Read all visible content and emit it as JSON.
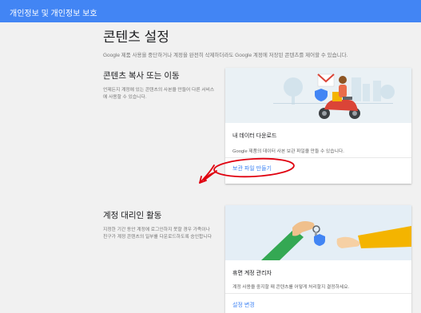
{
  "header": {
    "title": "개인정보 및 개인정보 보호"
  },
  "page": {
    "title": "콘텐츠 설정",
    "description": "Google 제품 사용을 중단하거나 계정을 완전히 삭제하더라도 Google 계정에 저장된 콘텐츠를 제어할 수 있습니다."
  },
  "sections": [
    {
      "title": "콘텐츠 복사 또는 이동",
      "description": "언제든지 계정에 있는 콘텐츠의 사본을 만들어 다른 서비스에 사용할 수 있습니다.",
      "card": {
        "title": "내 데이터 다운로드",
        "description": "Google 제품의 데이터 사본 보관 파일을 만들 수 있습니다.",
        "link": "보관 파일 만들기",
        "hero_color": "#eaf1f5"
      }
    },
    {
      "title": "계정 대리인 활동",
      "description": "지정한 기간 동안 계정에 로그인하지 못할 경우 가족이나 친구가 계정 콘텐츠의 일부를 다운로드하도록 승인합니다",
      "card": {
        "title": "휴면 계정 관리자",
        "description": "계정 사용을 중지할 때 콘텐츠를 어떻게 처리할지 결정하세요.",
        "link": "설정 변경",
        "hero_color": "#e4eef6"
      }
    }
  ],
  "colors": {
    "brand": "#4285f4",
    "link": "#4285f4",
    "annotation": "#e0000f"
  }
}
